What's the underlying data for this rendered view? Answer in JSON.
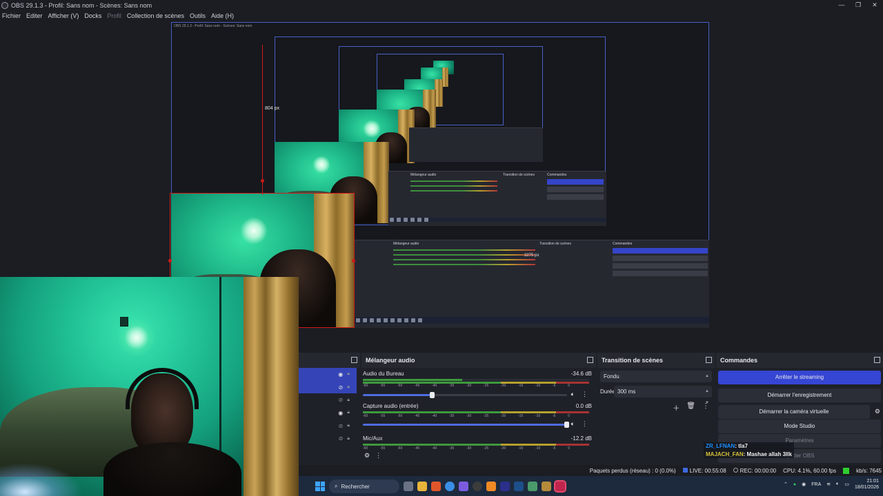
{
  "window": {
    "title": "OBS 29.1.3 - Profil: Sans nom - Scènes: Sans nom",
    "controls": [
      "—",
      "❐",
      "✕"
    ]
  },
  "menu": [
    "Fichier",
    "Editer",
    "Afficher (V)",
    "Docks",
    "Profil",
    "Collection de scènes",
    "Outils",
    "Aide (H)"
  ],
  "preview": {
    "size_label": "804 px",
    "nested_size_label": "2275 px"
  },
  "docks": {
    "scenes_header": "",
    "mixer_header": "Mélangeur audio",
    "transitions_header": "Transition de scènes",
    "commands_header": "Commandes"
  },
  "mixer": {
    "ticks": [
      "-60",
      "-55",
      "-50",
      "-45",
      "-40",
      "-35",
      "-30",
      "-25",
      "-20",
      "-15",
      "-10",
      "-5",
      "0"
    ],
    "channels": [
      {
        "name": "Audio du Bureau",
        "db": "-34.6 dB",
        "level": 0.44,
        "volume": 0.34
      },
      {
        "name": "Capture audio (entrée)",
        "db": "0.0 dB",
        "level": 0.0,
        "volume": 1.0
      },
      {
        "name": "Mic/Aux",
        "db": "-12.2 dB",
        "level": 0.0,
        "volume": 0.6
      }
    ]
  },
  "transitions": {
    "type": "Fondu",
    "duration_label": "Durée",
    "duration_value": "300 ms"
  },
  "commands": {
    "stop_streaming": "Arrêter le streaming",
    "start_recording": "Démarrer l'enregistrement",
    "start_virtual_cam": "Démarrer la caméra virtuelle",
    "studio_mode": "Mode Studio",
    "settings": "Paramètres",
    "quit": "Quitter OBS"
  },
  "chat": [
    {
      "user": "ZR_LFNAN",
      "message": ": tla7"
    },
    {
      "user": "MAJACH_FAN",
      "message": ": Mashae allah 3llk"
    }
  ],
  "status": {
    "dropped": "Paquets perdus (réseau) : 0 (0.0%)",
    "live": "LIVE: 00:55:08",
    "rec": "REC: 00:00:00",
    "cpu": "CPU: 4.1%, 60.00 fps",
    "kbps": "kb/s: 7645"
  },
  "taskbar": {
    "search_placeholder": "Rechercher",
    "lang": "FRA",
    "time": "21:01",
    "date": "18/01/2026"
  },
  "colors": {
    "accent_blue": "#3646d4",
    "selection_red": "#d01818",
    "meter_green": "#3e9a3e",
    "meter_yellow": "#b6a12c",
    "meter_red": "#a83232",
    "chat_user1": "#1e90ff",
    "chat_user2": "#d8c23a"
  }
}
